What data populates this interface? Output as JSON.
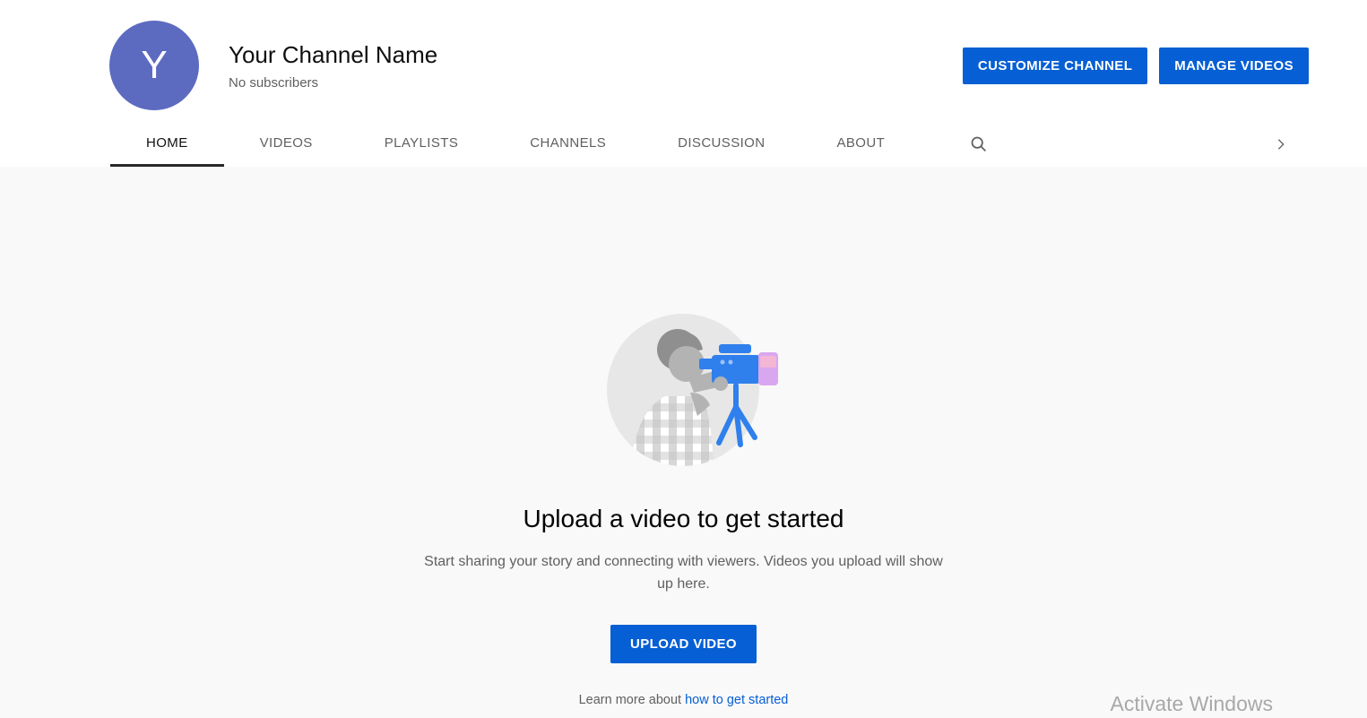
{
  "header": {
    "avatar_letter": "Y",
    "channel_name": "Your Channel Name",
    "subscriber_count": "No subscribers",
    "buttons": {
      "customize": "CUSTOMIZE CHANNEL",
      "manage": "MANAGE VIDEOS"
    }
  },
  "tabs": {
    "items": [
      {
        "label": "HOME",
        "active": true
      },
      {
        "label": "VIDEOS",
        "active": false
      },
      {
        "label": "PLAYLISTS",
        "active": false
      },
      {
        "label": "CHANNELS",
        "active": false
      },
      {
        "label": "DISCUSSION",
        "active": false
      },
      {
        "label": "ABOUT",
        "active": false
      }
    ],
    "icons": {
      "search": "search-icon",
      "more": "chevron-right-icon"
    }
  },
  "empty_state": {
    "title": "Upload a video to get started",
    "description": "Start sharing your story and connecting with viewers. Videos you upload will show up here.",
    "upload_button": "UPLOAD VIDEO",
    "learn_more_prefix": "Learn more about ",
    "learn_more_link": "how to get started"
  },
  "watermark": "Activate Windows",
  "colors": {
    "accent_blue": "#065fd4",
    "avatar_background": "#5c6bc0",
    "page_background": "#f9f9f9",
    "active_tab_underline": "#282828"
  }
}
